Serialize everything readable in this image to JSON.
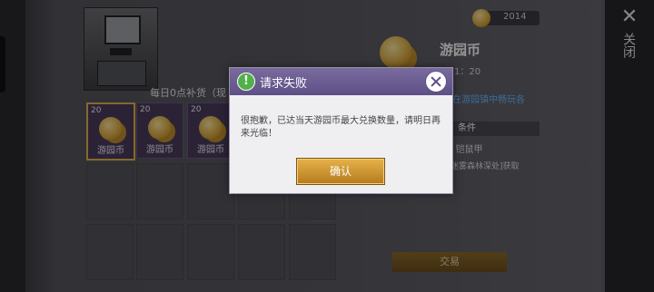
{
  "currency": {
    "value": "2014"
  },
  "daily_label": "每日0点补货（现",
  "shop_items": [
    {
      "count": "20",
      "name": "游园币"
    },
    {
      "count": "20",
      "name": "游园币"
    },
    {
      "count": "20",
      "name": "游园币"
    }
  ],
  "detail": {
    "title": "游园币",
    "owned": "1：20",
    "link": "在游园镇中畅玩各",
    "condition_label": "条件",
    "requirement_1": "2） 铠鼠甲",
    "requirement_2": "迷雾森林深处]获取"
  },
  "trade_button": "交易",
  "close_label": "关闭",
  "modal": {
    "title": "请求失败",
    "message": "很抱歉，已达当天游园币最大兑换数量，请明日再来光临！",
    "confirm": "确认"
  },
  "colors": {
    "modal_header": "#6b5c92",
    "confirm_button": "#d39a34",
    "alert_icon": "#52b04a",
    "link": "#6ab8ff"
  }
}
